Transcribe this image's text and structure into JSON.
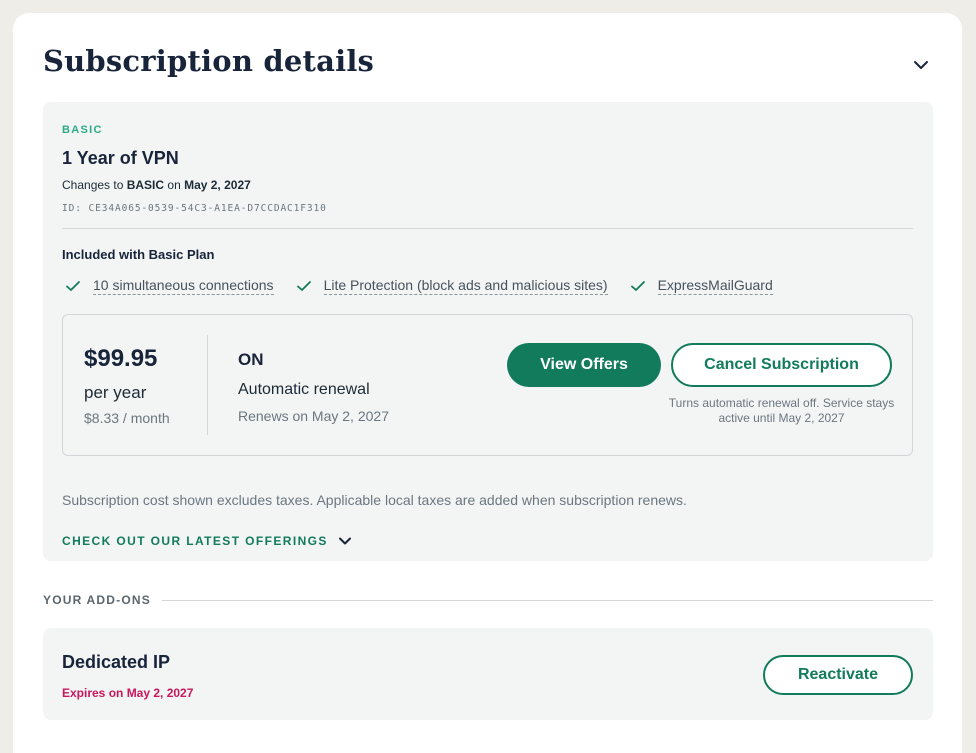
{
  "header": {
    "title": "Subscription details",
    "collapse_icon": "chevron-down-icon"
  },
  "plan": {
    "tier": "BASIC",
    "name": "1 Year of VPN",
    "changes_prefix": "Changes to ",
    "changes_tier": "BASIC",
    "changes_mid": " on ",
    "changes_date": "May 2, 2027",
    "id": "ID: CE34A065-0539-54C3-A1EA-D7CCDAC1F310",
    "included_title": "Included with Basic Plan",
    "features": [
      "10 simultaneous connections",
      "Lite Protection (block ads and malicious sites)",
      "ExpressMailGuard"
    ],
    "feature_icon": "checkmark-icon",
    "accent_color": "#117b5c"
  },
  "billing": {
    "price": "$99.95",
    "period": "per year",
    "monthly": "$8.33 / month",
    "renewal_status": "ON",
    "renewal_label": "Automatic renewal",
    "renewal_date": "Renews on May 2, 2027",
    "view_offers_label": "View Offers",
    "cancel_label": "Cancel Subscription",
    "cancel_note": "Turns automatic renewal off. Service stays active until May 2, 2027"
  },
  "tax_note": "Subscription cost shown excludes taxes. Applicable local taxes are added when subscription renews.",
  "latest_offerings_label": "CHECK OUT OUR LATEST OFFERINGS",
  "addons": {
    "heading": "YOUR ADD-ONS",
    "items": [
      {
        "name": "Dedicated IP",
        "expires": "Expires on May 2, 2027",
        "action_label": "Reactivate",
        "expires_color": "#c8175d"
      }
    ]
  }
}
